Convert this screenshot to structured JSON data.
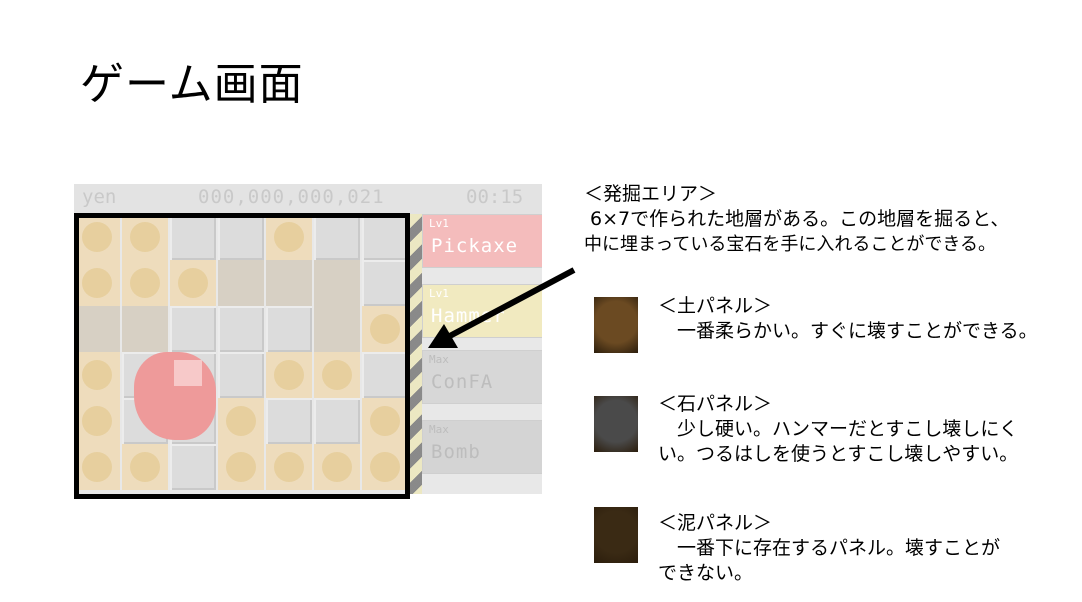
{
  "slide": {
    "title": "ゲーム画面"
  },
  "game": {
    "hud": {
      "yen_label": "yen",
      "money": "000,000,000,021",
      "time": "00:15"
    },
    "tools": [
      {
        "level": "Lv1",
        "name": "Pickaxe"
      },
      {
        "level": "Lv1",
        "name": "Hammer"
      },
      {
        "level": "Max",
        "name": "ConFA"
      },
      {
        "level": "Max",
        "name": "Bomb"
      }
    ]
  },
  "callout": {
    "heading": "＜発掘エリア＞",
    "line1": " 6×7で作られた地層がある。この地層を掘ると、",
    "line2": "中に埋まっている宝石を手に入れることができる。"
  },
  "panels": [
    {
      "heading": "＜土パネル＞",
      "text": "　一番柔らかい。すぐに壊すことができる。",
      "color": "#6b4a22"
    },
    {
      "heading": "＜石パネル＞",
      "text": "　少し硬い。ハンマーだとすこし壊しにく\nい。つるはしを使うとすこし壊しやすい。",
      "color": "#4a4a4a"
    },
    {
      "heading": "＜泥パネル＞",
      "text": "　一番下に存在するパネル。壊すことが\nできない。",
      "color": "#3a2a14"
    }
  ],
  "colors": {
    "frame": "#000000",
    "arrow": "#000000"
  }
}
